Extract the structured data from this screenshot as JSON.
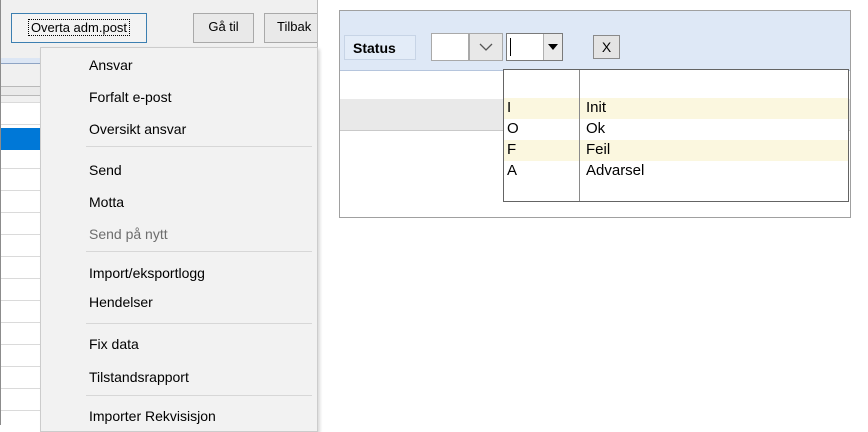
{
  "left_toolbar": {
    "buttons": [
      "Overta adm.post",
      "Gå til",
      "Tilbak"
    ]
  },
  "context_menu": {
    "items": [
      {
        "label": "Ansvar",
        "enabled": true
      },
      {
        "label": "Forfalt e-post",
        "enabled": true
      },
      {
        "label": "Oversikt ansvar",
        "enabled": true
      },
      {
        "label": "Send",
        "enabled": true
      },
      {
        "label": "Motta",
        "enabled": true
      },
      {
        "label": "Send på nytt",
        "enabled": false
      },
      {
        "label": "Import/eksportlogg",
        "enabled": true
      },
      {
        "label": "Hendelser",
        "enabled": true
      },
      {
        "label": "Fix data",
        "enabled": true
      },
      {
        "label": "Tilstandsrapport",
        "enabled": true
      },
      {
        "label": "Importer Rekvisisjon",
        "enabled": true
      }
    ]
  },
  "status_filter": {
    "label": "Status",
    "code_value": "",
    "combo_value": "",
    "clear_label": "X"
  },
  "status_dropdown": {
    "options": [
      {
        "code": "",
        "description": ""
      },
      {
        "code": "I",
        "description": "Init"
      },
      {
        "code": "O",
        "description": "Ok"
      },
      {
        "code": "F",
        "description": "Feil"
      },
      {
        "code": "A",
        "description": "Advarsel"
      }
    ]
  },
  "colors": {
    "toolbar_bg": "#dee8f6",
    "selection_blue": "#0078d7",
    "dropdown_alt_row": "#fbf7df",
    "disabled_text": "#6d6d6d"
  }
}
